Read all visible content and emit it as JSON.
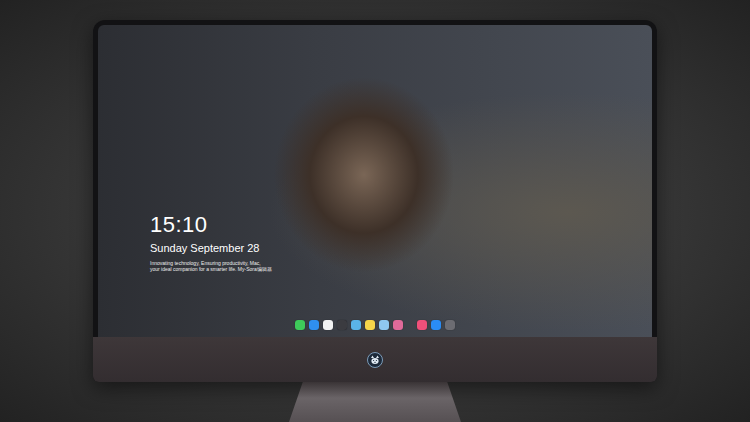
{
  "lock_screen": {
    "time": "15:10",
    "date": "Sunday September 28",
    "tagline": [
      "Innovating technology, Ensuring productivity, Mac,",
      "your ideal companion for a smarter life. My-Sora编辑器"
    ]
  },
  "dock": {
    "groups": [
      [
        {
          "color": "#3ec95a"
        },
        {
          "color": "#2f8ff0"
        },
        {
          "color": "#f2f2f2"
        },
        {
          "color": "#3b3b40"
        },
        {
          "color": "#5ab4e8"
        },
        {
          "color": "#f5d54a"
        },
        {
          "color": "#8fc8f0"
        },
        {
          "color": "#e06a9a"
        }
      ],
      [
        {
          "color": "#f0507a"
        },
        {
          "color": "#2a8cf5"
        },
        {
          "color": "#6c6c72"
        }
      ]
    ]
  }
}
